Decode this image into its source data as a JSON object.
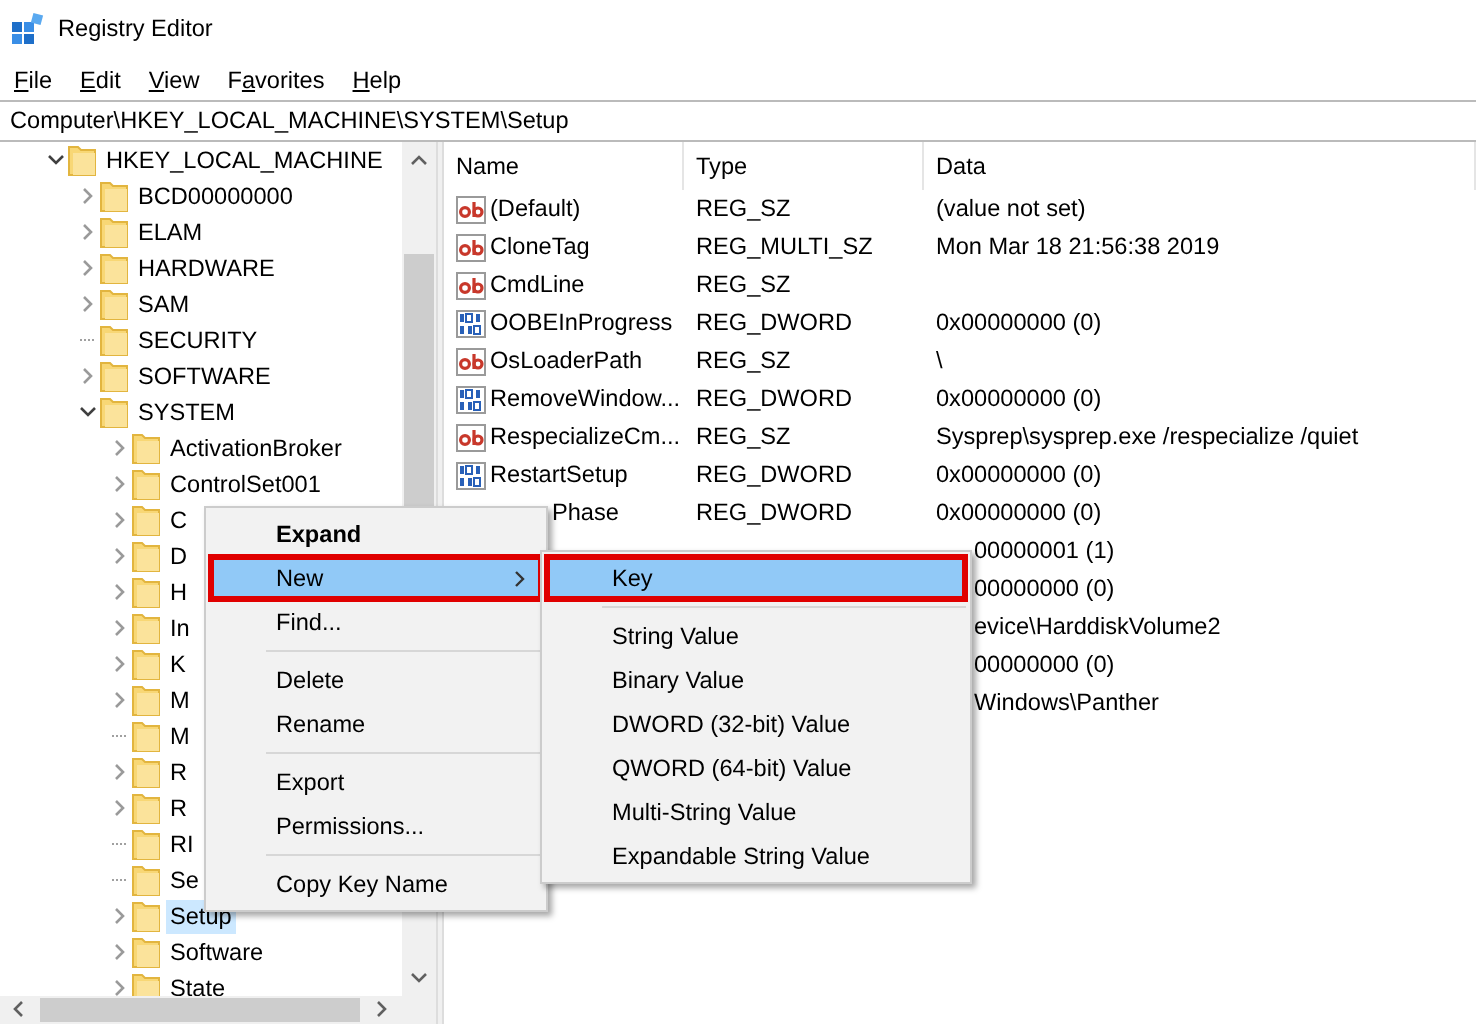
{
  "window": {
    "title": "Registry Editor"
  },
  "menu_bar": [
    {
      "access_key": "F",
      "rest": "ile"
    },
    {
      "access_key": "E",
      "rest": "dit"
    },
    {
      "access_key": "V",
      "rest": "iew"
    },
    {
      "lead": "F",
      "access_key": "a",
      "rest": "vorites"
    },
    {
      "access_key": "H",
      "rest": "elp"
    }
  ],
  "address": "Computer\\HKEY_LOCAL_MACHINE\\SYSTEM\\Setup",
  "tree": [
    {
      "label": "HKEY_LOCAL_MACHINE",
      "expandable": true,
      "expanded": true,
      "selected": false,
      "children": [
        {
          "label": "BCD00000000",
          "expandable": true,
          "expanded": false,
          "selected": false
        },
        {
          "label": "ELAM",
          "expandable": true,
          "expanded": false,
          "selected": false
        },
        {
          "label": "HARDWARE",
          "expandable": true,
          "expanded": false,
          "selected": false
        },
        {
          "label": "SAM",
          "expandable": true,
          "expanded": false,
          "selected": false
        },
        {
          "label": "SECURITY",
          "expandable": false,
          "selected": false
        },
        {
          "label": "SOFTWARE",
          "expandable": true,
          "expanded": false,
          "selected": false
        },
        {
          "label": "SYSTEM",
          "expandable": true,
          "expanded": true,
          "selected": false,
          "children": [
            {
              "label": "ActivationBroker",
              "expandable": true,
              "expanded": false,
              "selected": false
            },
            {
              "label": "ControlSet001",
              "expandable": true,
              "expanded": false,
              "selected": false
            },
            {
              "label": "C",
              "expandable": true,
              "expanded": false,
              "selected": false
            },
            {
              "label": "D",
              "expandable": true,
              "expanded": false,
              "selected": false
            },
            {
              "label": "H",
              "expandable": true,
              "expanded": false,
              "selected": false
            },
            {
              "label": "In",
              "expandable": true,
              "expanded": false,
              "selected": false
            },
            {
              "label": "K",
              "expandable": true,
              "expanded": false,
              "selected": false
            },
            {
              "label": "M",
              "expandable": true,
              "expanded": false,
              "selected": false
            },
            {
              "label": "M",
              "expandable": false,
              "selected": false
            },
            {
              "label": "R",
              "expandable": true,
              "expanded": false,
              "selected": false
            },
            {
              "label": "R",
              "expandable": true,
              "expanded": false,
              "selected": false
            },
            {
              "label": "RI",
              "expandable": false,
              "selected": false
            },
            {
              "label": "Se",
              "expandable": false,
              "selected": false
            },
            {
              "label": "Setup",
              "expandable": true,
              "expanded": false,
              "selected": true
            },
            {
              "label": "Software",
              "expandable": true,
              "expanded": false,
              "selected": false
            },
            {
              "label": "State",
              "expandable": true,
              "expanded": false,
              "selected": false
            }
          ]
        }
      ]
    }
  ],
  "list": {
    "columns": [
      "Name",
      "Type",
      "Data"
    ],
    "rows": [
      {
        "kind": "string",
        "name": "(Default)",
        "type": "REG_SZ",
        "data": "(value not set)",
        "covered": false
      },
      {
        "kind": "string",
        "name": "CloneTag",
        "type": "REG_MULTI_SZ",
        "data": "Mon Mar 18 21:56:38 2019",
        "covered": false
      },
      {
        "kind": "string",
        "name": "CmdLine",
        "type": "REG_SZ",
        "covered": false
      },
      {
        "kind": "binary",
        "name": "OOBEInProgress",
        "type": "REG_DWORD",
        "data": "0x00000000 (0)",
        "covered": false
      },
      {
        "kind": "string",
        "name": "OsLoaderPath",
        "type": "REG_SZ",
        "data": "\\",
        "covered": false
      },
      {
        "kind": "binary",
        "name": "RemoveWindow...",
        "type": "REG_DWORD",
        "data": "0x00000000 (0)",
        "covered": false
      },
      {
        "kind": "string",
        "name": "RespecializeCm...",
        "type": "REG_SZ",
        "data": "Sysprep\\sysprep.exe /respecialize /quiet",
        "covered": false
      },
      {
        "kind": "binary",
        "name": "RestartSetup",
        "type": "REG_DWORD",
        "data": "0x00000000 (0)",
        "covered": false
      },
      {
        "name": "Phase",
        "type": "REG_DWORD",
        "data": "0x00000000 (0)",
        "covered": true
      },
      {
        "data": "00000001 (1)",
        "covered": true
      },
      {
        "data": "00000000 (0)",
        "covered": true
      },
      {
        "data": "evice\\HarddiskVolume2",
        "covered": true
      },
      {
        "data": "00000000 (0)",
        "covered": true
      },
      {
        "data": "Windows\\Panther",
        "covered": true
      }
    ]
  },
  "context_menu": {
    "items": [
      {
        "kind": "item",
        "label": "Expand",
        "default": true,
        "selected": false,
        "submenu": false,
        "annotated": false
      },
      {
        "kind": "item",
        "label": "New",
        "default": false,
        "selected": true,
        "submenu": true,
        "annotated": true
      },
      {
        "kind": "item",
        "label": "Find...",
        "default": false,
        "selected": false,
        "submenu": false,
        "annotated": false
      },
      {
        "kind": "separator"
      },
      {
        "kind": "item",
        "label": "Delete",
        "default": false,
        "selected": false,
        "submenu": false,
        "annotated": false
      },
      {
        "kind": "item",
        "label": "Rename",
        "default": false,
        "selected": false,
        "submenu": false,
        "annotated": false
      },
      {
        "kind": "separator"
      },
      {
        "kind": "item",
        "label": "Export",
        "default": false,
        "selected": false,
        "submenu": false,
        "annotated": false
      },
      {
        "kind": "item",
        "label": "Permissions...",
        "default": false,
        "selected": false,
        "submenu": false,
        "annotated": false
      },
      {
        "kind": "separator"
      },
      {
        "kind": "item",
        "label": "Copy Key Name",
        "default": false,
        "selected": false,
        "submenu": false,
        "annotated": false
      }
    ]
  },
  "submenu": {
    "items": [
      {
        "kind": "item",
        "label": "Key",
        "selected": true,
        "annotated": true
      },
      {
        "kind": "separator"
      },
      {
        "kind": "item",
        "label": "String Value",
        "selected": false,
        "annotated": false
      },
      {
        "kind": "item",
        "label": "Binary Value",
        "selected": false,
        "annotated": false
      },
      {
        "kind": "item",
        "label": "DWORD (32-bit) Value",
        "selected": false,
        "annotated": false
      },
      {
        "kind": "item",
        "label": "QWORD (64-bit) Value",
        "selected": false,
        "annotated": false
      },
      {
        "kind": "item",
        "label": "Multi-String Value",
        "selected": false,
        "annotated": false
      },
      {
        "kind": "item",
        "label": "Expandable String Value",
        "selected": false,
        "annotated": false
      }
    ]
  }
}
